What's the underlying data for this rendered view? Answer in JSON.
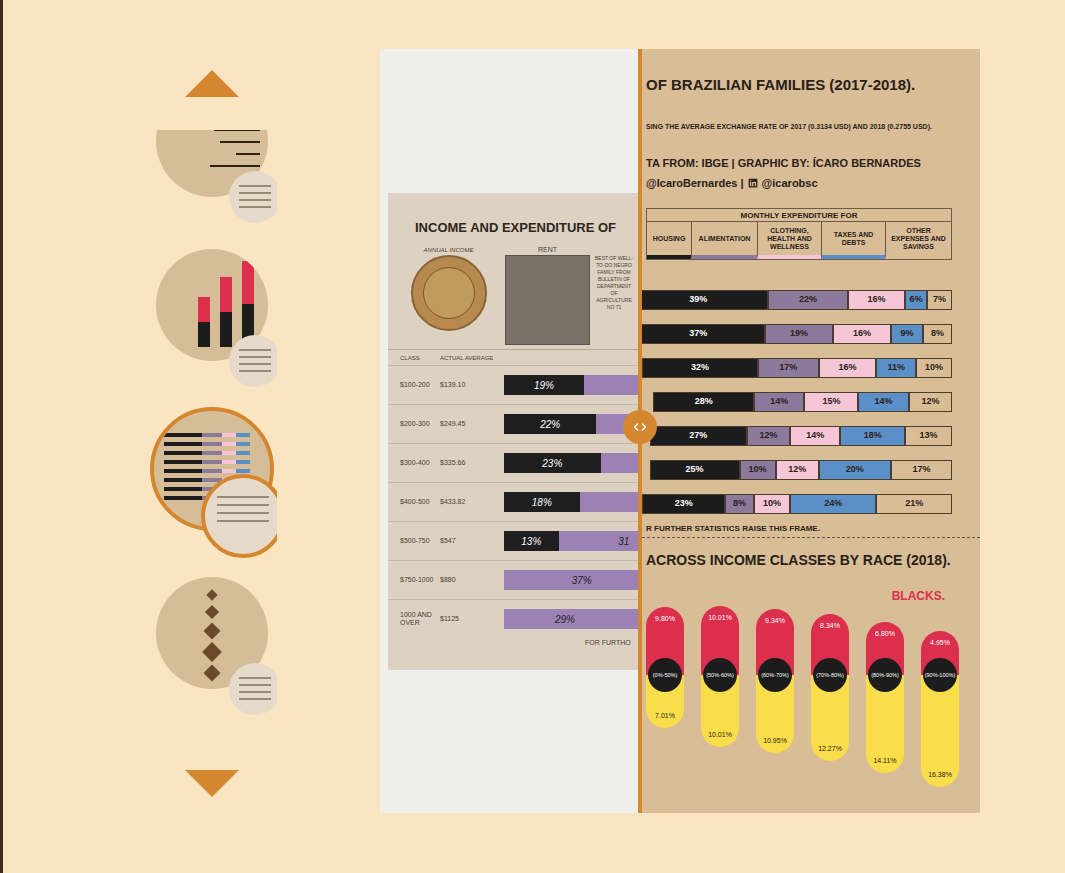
{
  "thumbnails": [
    {
      "kind": "lines",
      "selected": false
    },
    {
      "kind": "red-bars",
      "selected": false
    },
    {
      "kind": "table",
      "selected": true
    },
    {
      "kind": "vases",
      "selected": false
    }
  ],
  "comparison": {
    "level": 0.43
  },
  "original": {
    "title": "INCOME AND EXPENDITURE OF",
    "seal_label": "ANNUAL INCOME",
    "rent_header": "RENT",
    "note": "BEST OF WELL-TO-DO NEGRO FAMILY FROM BULLETIN OF DEPARTMENT OF AGRICULTURE NO 71",
    "columns": [
      "CLASS",
      "ACTUAL AVERAGE"
    ],
    "rows": [
      {
        "class": "$100-200",
        "average": "$139.10",
        "rent": 19,
        "rent_label": "19%",
        "food": 0,
        "food_label": ""
      },
      {
        "class": "$200-300",
        "average": "$249.45",
        "rent": 22,
        "rent_label": "22%",
        "food": 0,
        "food_label": ""
      },
      {
        "class": "$300-400",
        "average": "$335.66",
        "rent": 23,
        "rent_label": "23%",
        "food": 0,
        "food_label": ""
      },
      {
        "class": "$400-500",
        "average": "$433.82",
        "rent": 18,
        "rent_label": "18%",
        "food": 0,
        "food_label": ""
      },
      {
        "class": "$500-750",
        "average": "$547",
        "rent": 13,
        "rent_label": "13%",
        "food": 31,
        "food_label": "31"
      },
      {
        "class": "$750-1000",
        "average": "$880",
        "rent": 0,
        "rent_label": "",
        "food": 37,
        "food_label": "37%"
      },
      {
        "class": "1000 AND OVER",
        "average": "$1125",
        "rent": 0,
        "rent_label": "",
        "food": 29,
        "food_label": "29%"
      }
    ],
    "footer": "FOR FURTHO"
  },
  "recreation": {
    "title": "OF BRAZILIAN FAMILIES (2017-2018).",
    "subtitle": "SING THE AVERAGE EXCHANGE RATE OF 2017 (0.3134 USD) AND 2018 (0.2755 USD).",
    "credit": "TA FROM: IBGE | GRAPHIC BY: ÍCARO BERNARDES",
    "handle_before": "@IcaroBernardes |",
    "handle_after": "@icarobsc",
    "table_title": "MONTHLY EXPENDITURE FOR",
    "columns": [
      {
        "label": "HOUSING",
        "color": "#1c1c1c"
      },
      {
        "label": "ALIMENTATION",
        "color": "#8c7a9c"
      },
      {
        "label": "CLOTHING, HEALTH AND WELLNESS",
        "color": "#f7c6d6"
      },
      {
        "label": "TAXES AND DEBTS",
        "color": "#5b8fc7"
      },
      {
        "label": "OTHER EXPENSES AND SAVINGS",
        "color": "#d8bd97"
      }
    ],
    "rows": [
      {
        "values": [
          39,
          22,
          16,
          6,
          7
        ],
        "labels": [
          "39%",
          "22%",
          "16%",
          "6%",
          "7%"
        ]
      },
      {
        "values": [
          37,
          19,
          16,
          9,
          8
        ],
        "labels": [
          "37%",
          "19%",
          "16%",
          "9%",
          "8%"
        ]
      },
      {
        "values": [
          32,
          17,
          16,
          11,
          10
        ],
        "labels": [
          "32%",
          "17%",
          "16%",
          "11%",
          "10%"
        ]
      },
      {
        "values": [
          28,
          14,
          15,
          14,
          12
        ],
        "labels": [
          "28%",
          "14%",
          "15%",
          "14%",
          "12%"
        ]
      },
      {
        "values": [
          27,
          12,
          14,
          18,
          13
        ],
        "labels": [
          "27%",
          "12%",
          "14%",
          "18%",
          "13%"
        ]
      },
      {
        "values": [
          25,
          10,
          12,
          20,
          17
        ],
        "labels": [
          "25%",
          "10%",
          "12%",
          "20%",
          "17%"
        ]
      },
      {
        "values": [
          23,
          8,
          10,
          24,
          21
        ],
        "labels": [
          "23%",
          "8%",
          "10%",
          "24%",
          "21%"
        ]
      }
    ],
    "footer": "R FURTHER STATISTICS RAISE THIS FRAME.",
    "race_title": "ACROSS INCOME CLASSES BY RACE (2018).",
    "legend": {
      "label": "BLACKS.",
      "color": "#dc2f4e"
    },
    "classes": [
      {
        "label": "(0%-50%)",
        "blacks": 9.8,
        "blacks_label": "9.80%",
        "others": 7.01,
        "others_label": "7.01%"
      },
      {
        "label": "(50%-60%)",
        "blacks": 10.01,
        "blacks_label": "10.01%",
        "others": 10.01,
        "others_label": "10.01%"
      },
      {
        "label": "(60%-70%)",
        "blacks": 9.34,
        "blacks_label": "9.34%",
        "others": 10.95,
        "others_label": "10.95%"
      },
      {
        "label": "(70%-80%)",
        "blacks": 8.34,
        "blacks_label": "8.34%",
        "others": 12.27,
        "others_label": "12.27%"
      },
      {
        "label": "(80%-90%)",
        "blacks": 6.8,
        "blacks_label": "6.80%",
        "others": 14.11,
        "others_label": "14.11%"
      },
      {
        "label": "(90%-100%)",
        "blacks": 4.95,
        "blacks_label": "4.95%",
        "others": 16.38,
        "others_label": "16.38%"
      }
    ]
  }
}
